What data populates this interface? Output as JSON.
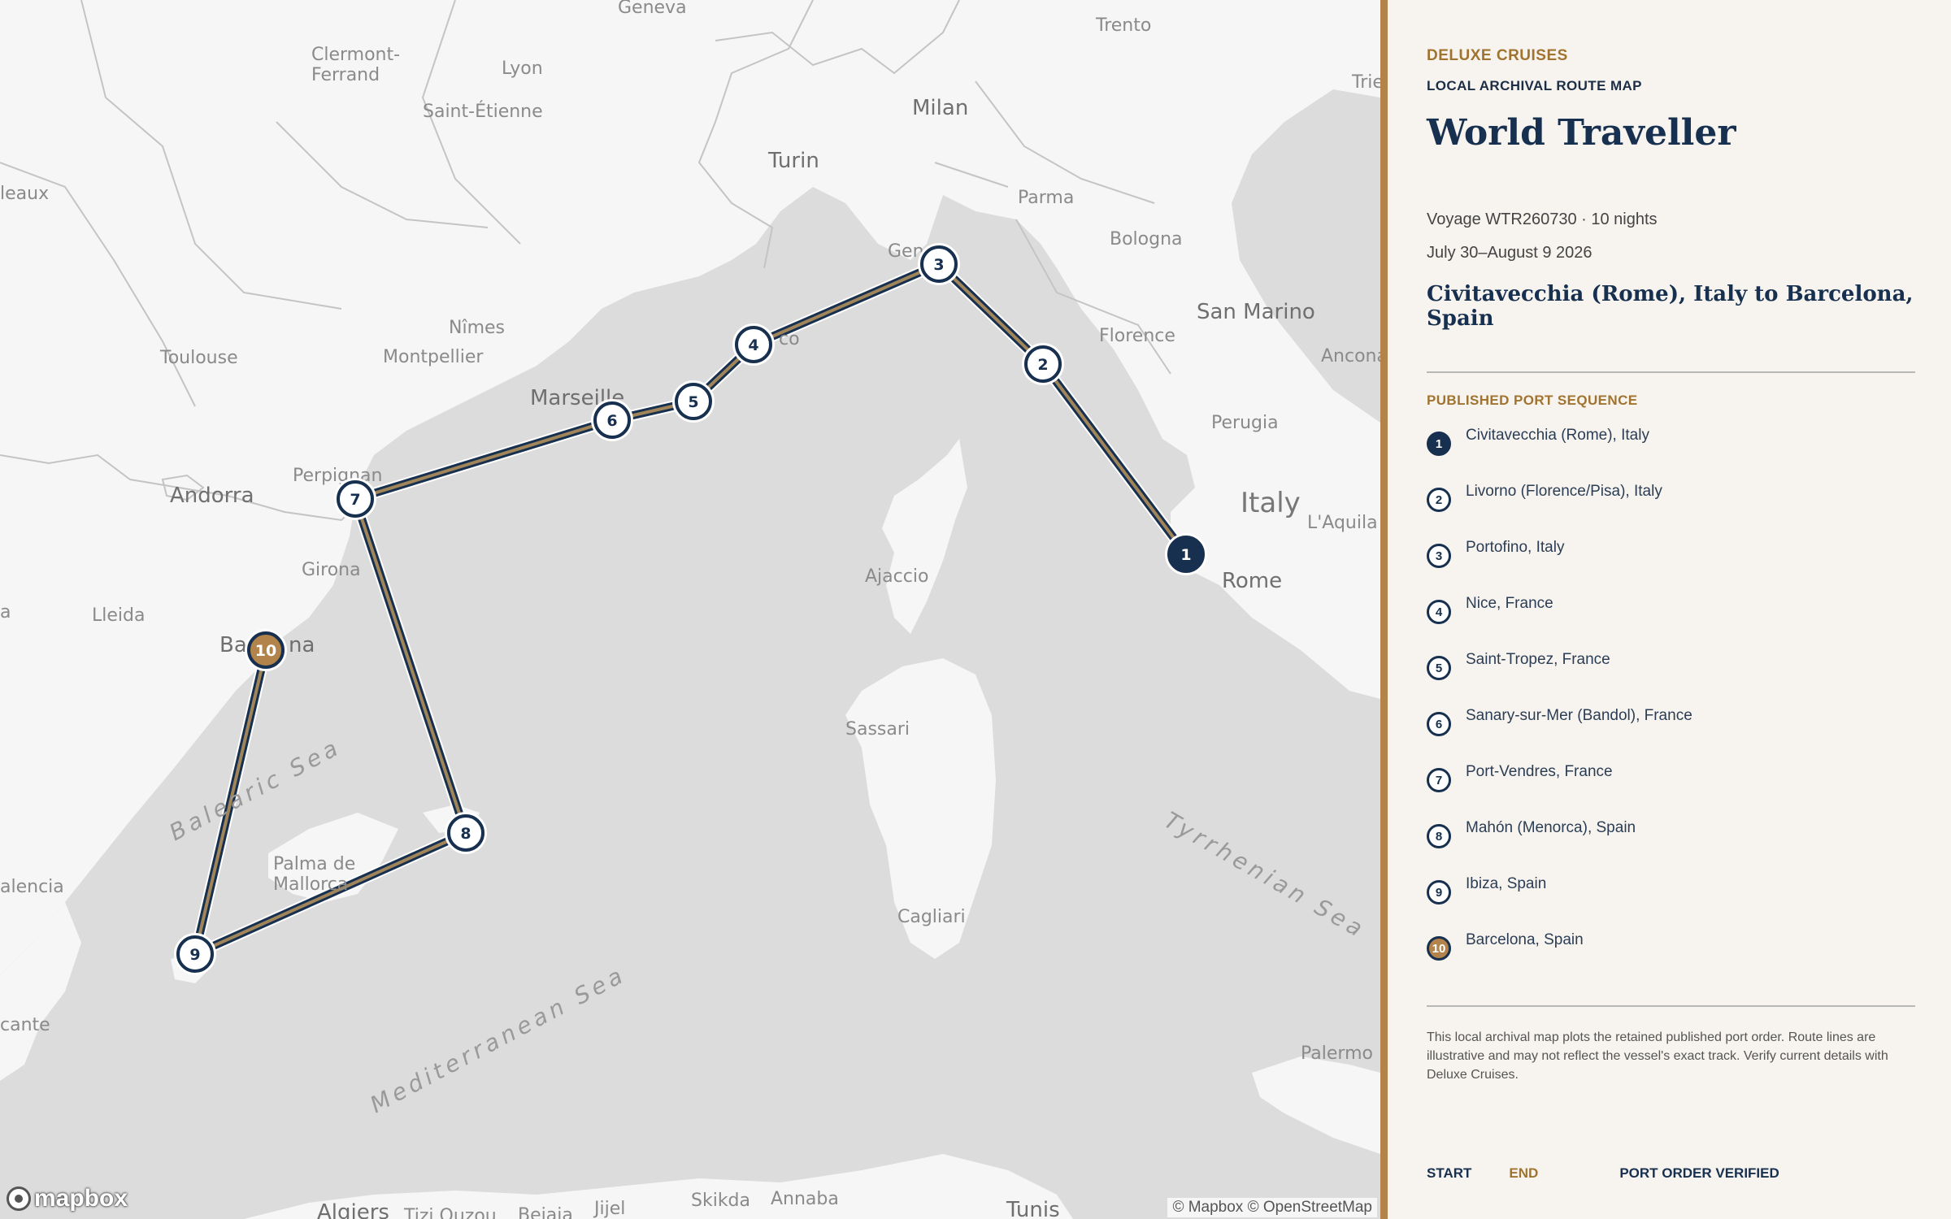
{
  "map": {
    "attribution": "© Mapbox © OpenStreetMap",
    "logo_text": "mapbox",
    "colors": {
      "land": "#f6f6f6",
      "sea": "#dcdcdc",
      "border": "#c4c4c4",
      "route": "#a0845a",
      "route_casing": "#17304f",
      "marker_ring": "#17304f",
      "start": "#17304f",
      "end": "#b2834a"
    },
    "places": [
      {
        "id": "geneva",
        "name": "Geneva"
      },
      {
        "id": "trento",
        "name": "Trento"
      },
      {
        "id": "trieste",
        "name": "Trie"
      },
      {
        "id": "clermont",
        "name": "Clermont-\nFerrand"
      },
      {
        "id": "lyon",
        "name": "Lyon"
      },
      {
        "id": "saint-etienne",
        "name": "Saint-Étienne"
      },
      {
        "id": "milan",
        "name": "Milan"
      },
      {
        "id": "turin",
        "name": "Turin"
      },
      {
        "id": "parma",
        "name": "Parma"
      },
      {
        "id": "bologna",
        "name": "Bologna"
      },
      {
        "id": "bordeaux",
        "name": "leaux"
      },
      {
        "id": "genoa",
        "name": "Gen"
      },
      {
        "id": "san-marino",
        "name": "San Marino"
      },
      {
        "id": "florence",
        "name": "Florence"
      },
      {
        "id": "ancona",
        "name": "Ancona"
      },
      {
        "id": "nimes",
        "name": "Nîmes"
      },
      {
        "id": "toulouse",
        "name": "Toulouse"
      },
      {
        "id": "montpellier",
        "name": "Montpellier"
      },
      {
        "id": "monaco",
        "name": "co"
      },
      {
        "id": "marseille",
        "name": "Marseille"
      },
      {
        "id": "perugia",
        "name": "Perugia"
      },
      {
        "id": "perpignan",
        "name": "Perpignan"
      },
      {
        "id": "andorra",
        "name": "Andorra"
      },
      {
        "id": "italy",
        "name": "Italy"
      },
      {
        "id": "laquila",
        "name": "L'Aquila"
      },
      {
        "id": "rome",
        "name": "Rome"
      },
      {
        "id": "girona",
        "name": "Girona"
      },
      {
        "id": "ajaccio",
        "name": "Ajaccio"
      },
      {
        "id": "lleida",
        "name": "Lleida"
      },
      {
        "id": "za",
        "name": "a"
      },
      {
        "id": "barcelona-a",
        "name": "Ba"
      },
      {
        "id": "barcelona-b",
        "name": "na"
      },
      {
        "id": "sassari",
        "name": "Sassari"
      },
      {
        "id": "palma",
        "name": "Palma de\nMallorca"
      },
      {
        "id": "valencia",
        "name": "alencia"
      },
      {
        "id": "cagliari",
        "name": "Cagliari"
      },
      {
        "id": "alicante",
        "name": "cante"
      },
      {
        "id": "palermo",
        "name": "Palermo"
      },
      {
        "id": "algiers",
        "name": "Algiers"
      },
      {
        "id": "tizi",
        "name": "Tizi Ouzou"
      },
      {
        "id": "bejaia",
        "name": "Bejaia"
      },
      {
        "id": "jijel",
        "name": "Jijel"
      },
      {
        "id": "skikda",
        "name": "Skikda"
      },
      {
        "id": "annaba",
        "name": "Annaba"
      },
      {
        "id": "tunis",
        "name": "Tunis"
      }
    ],
    "seas": [
      {
        "id": "balearic",
        "name": "Balearic Sea"
      },
      {
        "id": "tyrrhenian",
        "name": "Tyrrhenian Sea"
      },
      {
        "id": "mediterranean",
        "name": "Mediterranean Sea"
      }
    ],
    "stops": [
      {
        "n": "1",
        "role": "start"
      },
      {
        "n": "2",
        "role": "mid"
      },
      {
        "n": "3",
        "role": "mid"
      },
      {
        "n": "4",
        "role": "mid"
      },
      {
        "n": "5",
        "role": "mid"
      },
      {
        "n": "6",
        "role": "mid"
      },
      {
        "n": "7",
        "role": "mid"
      },
      {
        "n": "8",
        "role": "mid"
      },
      {
        "n": "9",
        "role": "mid"
      },
      {
        "n": "10",
        "role": "end"
      }
    ]
  },
  "panel": {
    "brand": "DELUXE CRUISES",
    "subtitle": "LOCAL ARCHIVAL ROUTE MAP",
    "ship": "World Traveller",
    "voyage": "Voyage WTR260730 · 10 nights",
    "dates": "July 30–August 9 2026",
    "route_title": "Civitavecchia (Rome), Italy to Barcelona, Spain",
    "sequence_heading": "PUBLISHED PORT SEQUENCE",
    "ports": [
      {
        "n": "1",
        "name": "Civitavecchia (Rome), Italy",
        "role": "start"
      },
      {
        "n": "2",
        "name": "Livorno (Florence/Pisa), Italy",
        "role": "mid"
      },
      {
        "n": "3",
        "name": "Portofino, Italy",
        "role": "mid"
      },
      {
        "n": "4",
        "name": "Nice, France",
        "role": "mid"
      },
      {
        "n": "5",
        "name": "Saint-Tropez, France",
        "role": "mid"
      },
      {
        "n": "6",
        "name": "Sanary-sur-Mer (Bandol), France",
        "role": "mid"
      },
      {
        "n": "7",
        "name": "Port-Vendres, France",
        "role": "mid"
      },
      {
        "n": "8",
        "name": "Mahón (Menorca), Spain",
        "role": "mid"
      },
      {
        "n": "9",
        "name": "Ibiza, Spain",
        "role": "mid"
      },
      {
        "n": "10",
        "name": "Barcelona, Spain",
        "role": "end"
      }
    ],
    "note": "This local archival map plots the retained published port order. Route lines are illustrative and may not reflect the vessel's exact track. Verify current details with Deluxe Cruises.",
    "legend": {
      "start": "START",
      "end": "END",
      "verified": "PORT ORDER VERIFIED"
    }
  }
}
